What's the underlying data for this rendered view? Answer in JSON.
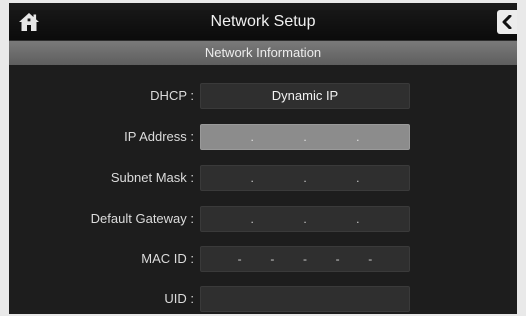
{
  "header": {
    "title": "Network Setup"
  },
  "section": {
    "title": "Network Information"
  },
  "icons": {
    "home": "home-icon",
    "back": "chevron-left-icon"
  },
  "fields": [
    {
      "label": "DHCP :",
      "value": "Dynamic IP",
      "separators": []
    },
    {
      "label": "IP Address :",
      "value": "",
      "separators": [
        ".",
        ".",
        "."
      ]
    },
    {
      "label": "Subnet Mask :",
      "value": "",
      "separators": [
        ".",
        ".",
        "."
      ]
    },
    {
      "label": "Default Gateway :",
      "value": "",
      "separators": [
        ".",
        ".",
        "."
      ]
    },
    {
      "label": "MAC ID :",
      "value": "",
      "separators": [
        "-",
        "-",
        "-",
        "-",
        "-"
      ]
    },
    {
      "label": "UID :",
      "value": "",
      "separators": []
    }
  ],
  "colors": {
    "active_field": "#8c8c8c",
    "field": "#2f2f2f",
    "background": "#1d1d1d"
  }
}
